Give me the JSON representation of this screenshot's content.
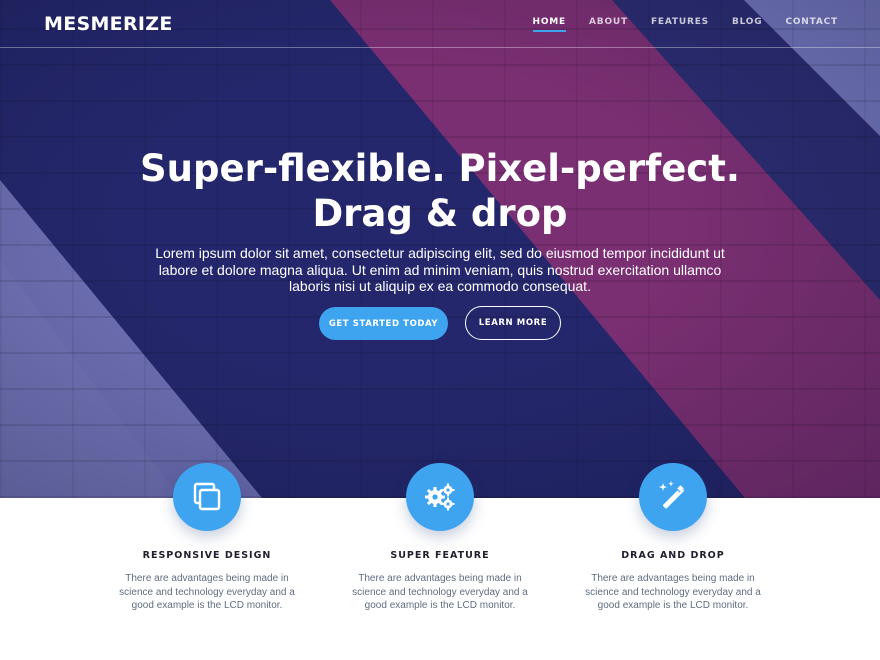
{
  "header": {
    "logo": "MESMERIZE",
    "nav": [
      "HOME",
      "ABOUT",
      "FEATURES",
      "BLOG",
      "CONTACT"
    ],
    "active_nav": "HOME"
  },
  "hero": {
    "title_line1": "Super-flexible. Pixel-perfect.",
    "title_line2": "Drag & drop",
    "subtitle": "Lorem ipsum dolor sit amet, consectetur adipiscing elit, sed do eiusmod tempor incididunt ut labore et dolore magna aliqua. Ut enim ad minim veniam, quis nostrud exercitation ullamco laboris nisi ut aliquip ex ea commodo consequat.",
    "primary_button": "GET STARTED TODAY",
    "secondary_button": "LEARN MORE"
  },
  "features": [
    {
      "icon": "windows-icon",
      "title": "RESPONSIVE DESIGN",
      "text": "There are advantages being made in science and technology everyday and a good example is the LCD monitor."
    },
    {
      "icon": "gears-icon",
      "title": "SUPER FEATURE",
      "text": "There are advantages being made in science and technology everyday and a good example is the LCD monitor."
    },
    {
      "icon": "magic-wand-icon",
      "title": "DRAG AND DROP",
      "text": "There are advantages being made in science and technology everyday and a good example is the LCD monitor."
    }
  ],
  "colors": {
    "accent": "#3fa4f0",
    "hero_navy": "#23256a",
    "hero_magenta": "#7a2f72",
    "hero_lavender": "#6f73b6"
  }
}
